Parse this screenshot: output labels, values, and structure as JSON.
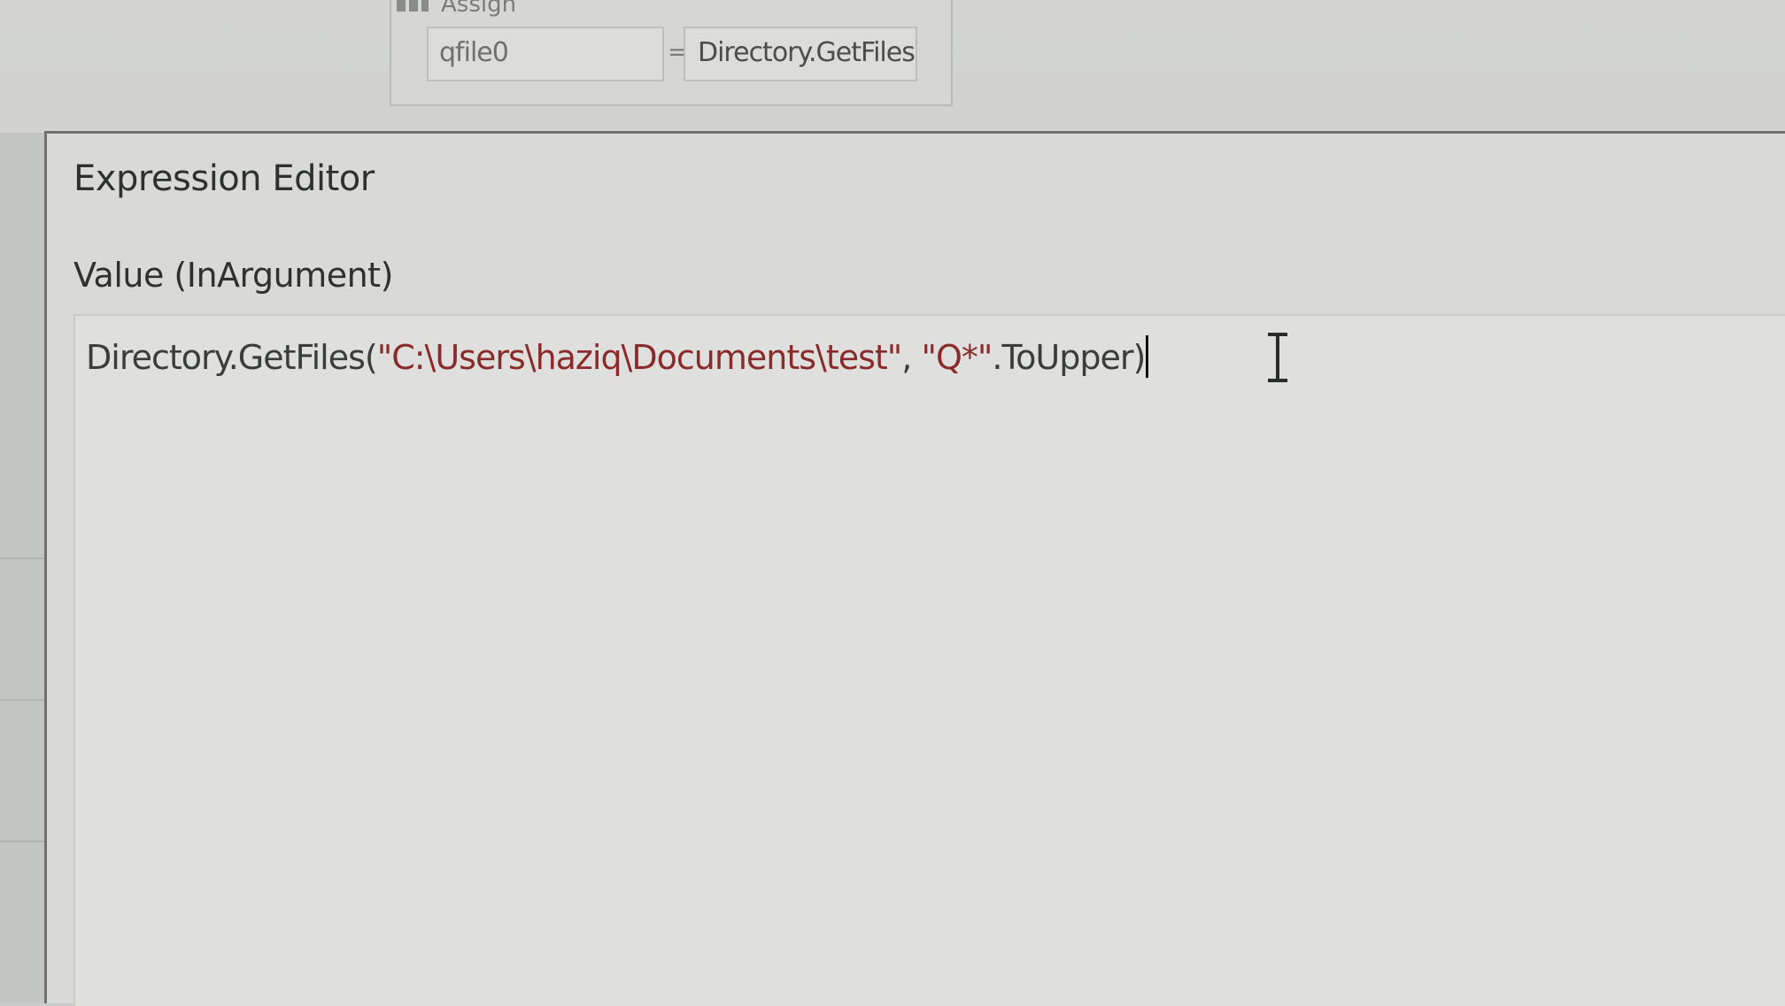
{
  "assign": {
    "title": "Assign",
    "to_value": "qfile0",
    "equals": "=",
    "value_preview": "Directory.GetFiles("
  },
  "dialog": {
    "title": "Expression Editor",
    "field_label": "Value (InArgument)",
    "expression": {
      "func": "Directory.GetFiles(",
      "path_string": "\"C:\\Users\\haziq\\Documents\\test\"",
      "separator": ", ",
      "pattern_string": "\"Q*\"",
      "method": ".ToUpper)"
    }
  },
  "icons": {
    "assign": "assign-icon",
    "cursor": "text-cursor-icon"
  }
}
